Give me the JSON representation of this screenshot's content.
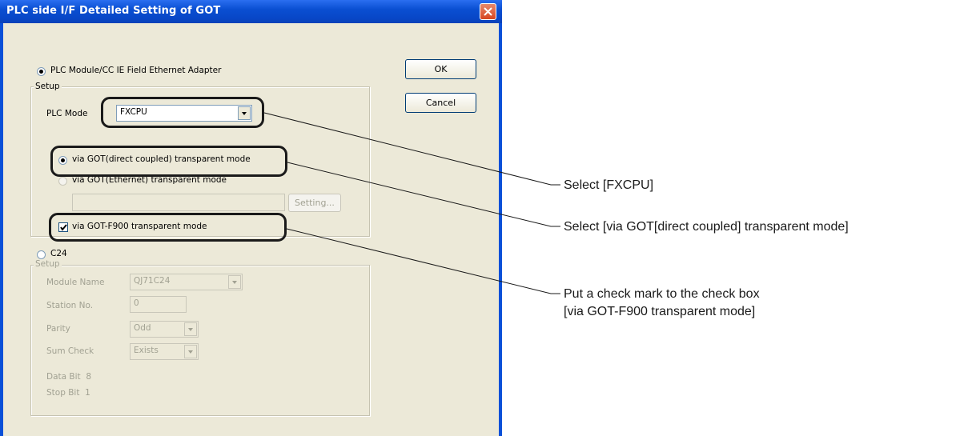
{
  "window": {
    "title": "PLC side I/F Detailed Setting of GOT",
    "close_icon": "close-icon"
  },
  "buttons": {
    "ok": "OK",
    "cancel": "Cancel",
    "setting": "Setting..."
  },
  "plc_module": {
    "label": "PLC Module/CC IE Field Ethernet Adapter",
    "selected": true,
    "setup_legend": "Setup",
    "plc_model_label": "PLC Mode",
    "plc_model_value": "FXCPU",
    "via_got_direct": {
      "label": "via GOT(direct coupled) transparent mode",
      "selected": true
    },
    "via_got_ethernet": {
      "label": "via GOT(Ethernet) transparent mode",
      "selected": false,
      "enabled": false
    },
    "via_got_f900": {
      "label": "via GOT-F900 transparent mode",
      "checked": true
    }
  },
  "c24": {
    "label": "C24",
    "selected": false,
    "setup_legend": "Setup",
    "module_name_label": "Module Name",
    "module_name_value": "QJ71C24",
    "station_no_label": "Station No.",
    "station_no_value": "0",
    "parity_label": "Parity",
    "parity_value": "Odd",
    "sum_check_label": "Sum Check",
    "sum_check_value": "Exists",
    "data_bit": "Data Bit  8",
    "stop_bit": "Stop Bit  1"
  },
  "annotations": {
    "a1": "Select [FXCPU]",
    "a2": "Select [via GOT[direct coupled] transparent mode]",
    "a3_line1": "Put a check mark to the check box",
    "a3_line2": "[via GOT-F900 transparent mode]"
  }
}
